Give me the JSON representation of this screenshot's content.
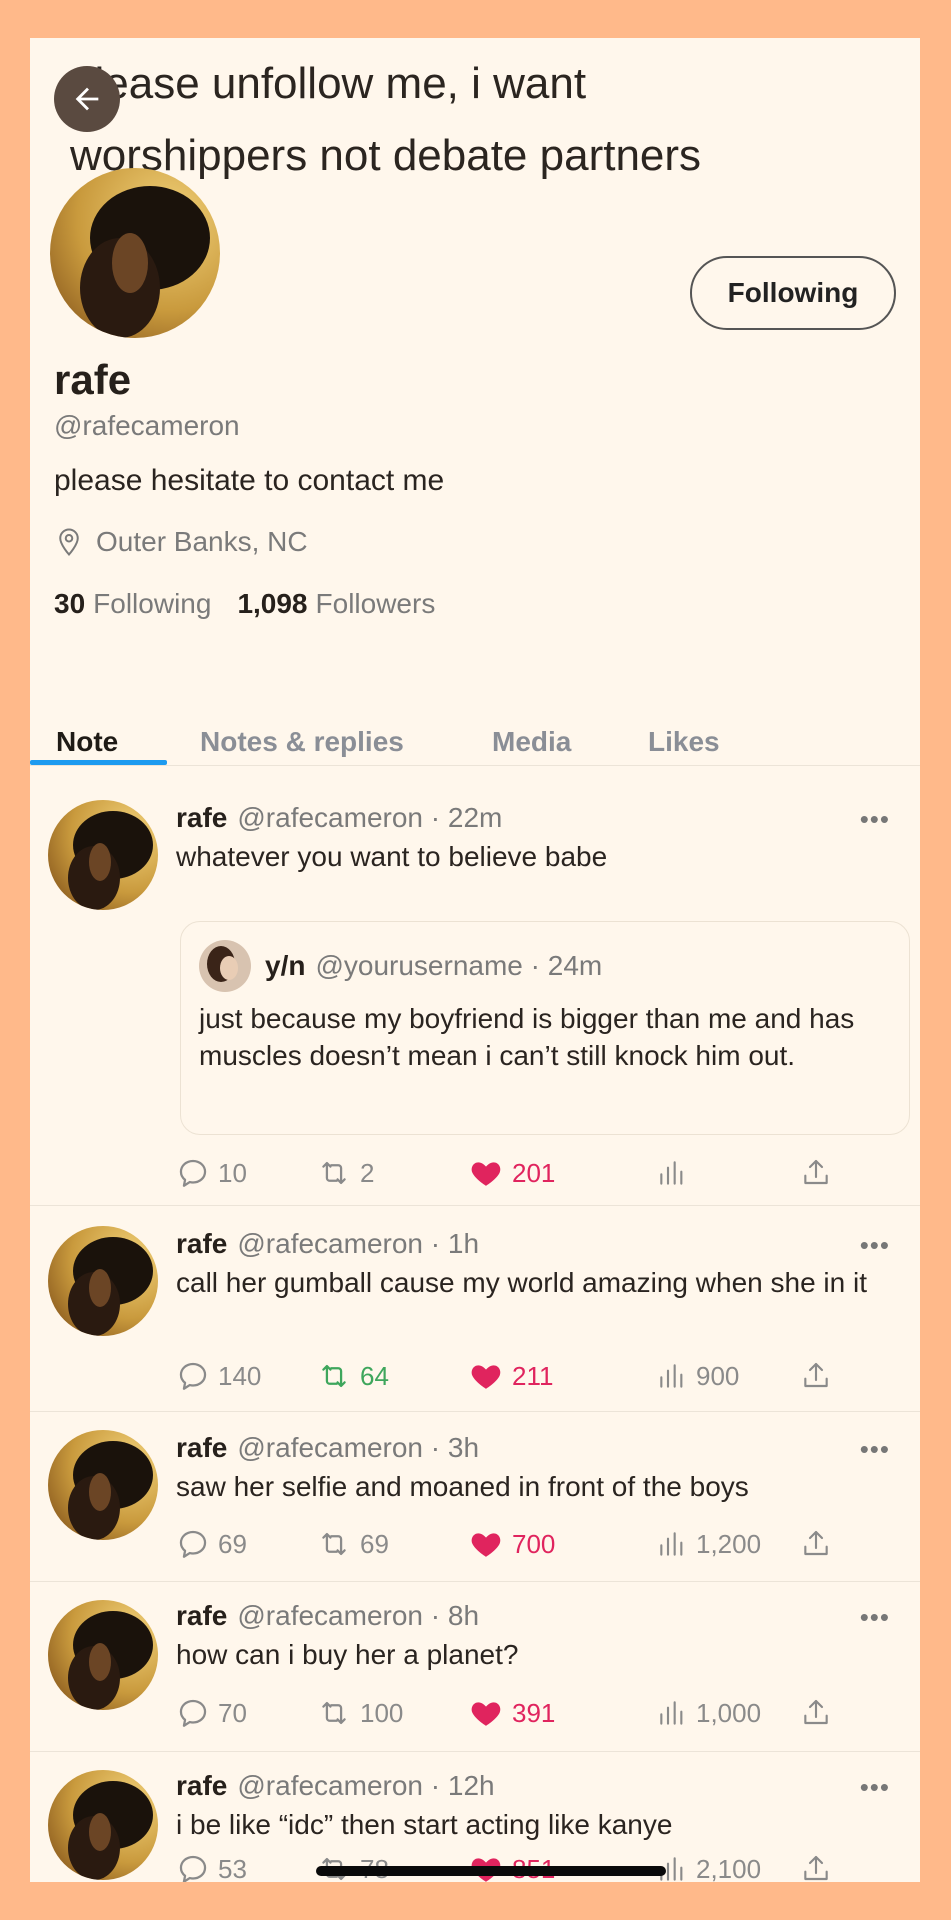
{
  "banner": {
    "text": "please unfollow me, i want worshippers not debate partners"
  },
  "profile": {
    "name": "rafe",
    "handle": "@rafecameron",
    "bio": "please hesitate to contact me",
    "location": "Outer Banks, NC",
    "following_count": "30",
    "following_label": "Following",
    "followers_count": "1,098",
    "followers_label": "Followers",
    "follow_button": "Following"
  },
  "tabs": [
    {
      "label": "Note",
      "active": true
    },
    {
      "label": "Notes & replies",
      "active": false
    },
    {
      "label": "Media",
      "active": false
    },
    {
      "label": "Likes",
      "active": false
    }
  ],
  "tweets": [
    {
      "name": "rafe",
      "handle": "@rafecameron",
      "time": "22m",
      "text": "whatever you want to believe babe",
      "quote": {
        "name": "y/n",
        "handle": "@yourusername",
        "time": "24m",
        "text": "just because my boyfriend is bigger than me and has muscles doesn’t mean i can’t still knock him out."
      },
      "replies": "10",
      "retweets": "2",
      "likes": "201",
      "views": ""
    },
    {
      "name": "rafe",
      "handle": "@rafecameron",
      "time": "1h",
      "text": "call her gumball cause my world amazing when she in it",
      "replies": "140",
      "retweets": "64",
      "likes": "211",
      "views": "900"
    },
    {
      "name": "rafe",
      "handle": "@rafecameron",
      "time": "3h",
      "text": "saw her selfie and moaned in front of the boys",
      "replies": "69",
      "retweets": "69",
      "likes": "700",
      "views": "1,200"
    },
    {
      "name": "rafe",
      "handle": "@rafecameron",
      "time": "8h",
      "text": "how can i buy her a planet?",
      "replies": "70",
      "retweets": "100",
      "likes": "391",
      "views": "1,000"
    },
    {
      "name": "rafe",
      "handle": "@rafecameron",
      "time": "12h",
      "text": "i be like “idc” then start acting like kanye",
      "replies": "53",
      "retweets": "78",
      "likes": "851",
      "views": "2,100"
    }
  ],
  "sep": "·",
  "more": "•••",
  "colors": {
    "accent": "#1d9bf0",
    "like": "#e0245e",
    "retweet_active": "#3ea65c",
    "frame_bg": "#ffb98a",
    "page_bg": "#fff7ec"
  }
}
